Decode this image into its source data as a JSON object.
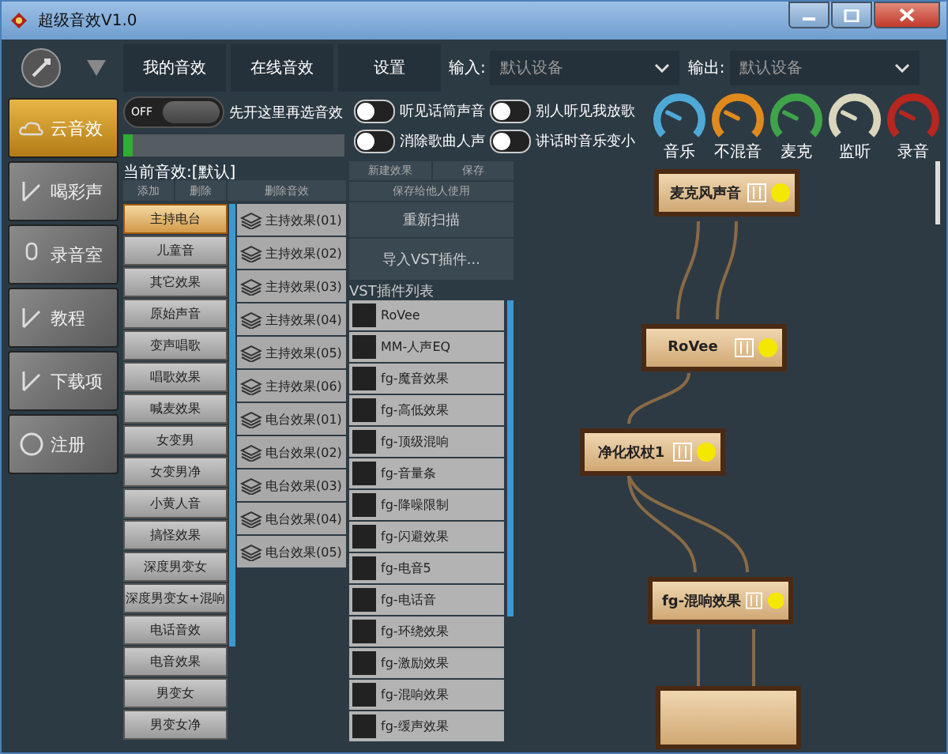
{
  "window": {
    "title": "超级音效V1.0"
  },
  "sidebar": {
    "items": [
      {
        "label": "云音效",
        "selected": true
      },
      {
        "label": "喝彩声",
        "selected": false
      },
      {
        "label": "录音室",
        "selected": false
      },
      {
        "label": "教程",
        "selected": false
      },
      {
        "label": "下载项",
        "selected": false
      },
      {
        "label": "注册",
        "selected": false
      }
    ]
  },
  "tabs": [
    {
      "label": "我的音效",
      "selected": false
    },
    {
      "label": "在线音效",
      "selected": false
    },
    {
      "label": "设置",
      "selected": false
    }
  ],
  "input": {
    "label": "输入:",
    "value": "默认设备"
  },
  "output": {
    "label": "输出:",
    "value": "默认设备"
  },
  "main_switch": {
    "label": "OFF",
    "on": false,
    "hint": "先开这里再选音效"
  },
  "input_meter": {
    "level": 0.04
  },
  "toggles": [
    {
      "label": "听见话筒声音",
      "on": false
    },
    {
      "label": "别人听见我放歌",
      "on": false
    },
    {
      "label": "消除歌曲人声",
      "on": false
    },
    {
      "label": "讲话时音乐变小",
      "on": false
    }
  ],
  "gauges": [
    {
      "label": "音乐",
      "color": "#4fa9d6"
    },
    {
      "label": "不混音",
      "color": "#e08a1e"
    },
    {
      "label": "麦克",
      "color": "#3fa34a"
    },
    {
      "label": "监听",
      "color": "#d9d6bd"
    },
    {
      "label": "录音",
      "color": "#b8261f"
    }
  ],
  "current_effect": "当前音效:[默认]",
  "effect_columns": [
    "添加",
    "删除",
    "删除音效"
  ],
  "effects": [
    {
      "label": "主持电台",
      "selected": true
    },
    {
      "label": "儿童音",
      "selected": false
    },
    {
      "label": "其它效果",
      "selected": false
    },
    {
      "label": "原始声音",
      "selected": false
    },
    {
      "label": "变声唱歌",
      "selected": false
    },
    {
      "label": "唱歌效果",
      "selected": false
    },
    {
      "label": "喊麦效果",
      "selected": false
    },
    {
      "label": "女变男",
      "selected": false
    },
    {
      "label": "女变男净",
      "selected": false
    },
    {
      "label": "小黄人音",
      "selected": false
    },
    {
      "label": "搞怪效果",
      "selected": false
    },
    {
      "label": "深度男变女",
      "selected": false
    },
    {
      "label": "深度男变女+混响",
      "selected": false
    },
    {
      "label": "电话音效",
      "selected": false
    },
    {
      "label": "电音效果",
      "selected": false
    },
    {
      "label": "男变女",
      "selected": false
    },
    {
      "label": "男变女净",
      "selected": false
    }
  ],
  "presets": [
    "主持效果(01)",
    "主持效果(02)",
    "主持效果(03)",
    "主持效果(04)",
    "主持效果(05)",
    "主持效果(06)",
    "电台效果(01)",
    "电台效果(02)",
    "电台效果(03)",
    "电台效果(04)",
    "电台效果(05)"
  ],
  "vst_panel": {
    "buttons": [
      "新建效果",
      "保存"
    ],
    "share_button": "保存给他人使用",
    "rescan_button": "重新扫描",
    "import_button": "导入VST插件...",
    "list_title": "VST插件列表",
    "plugins": [
      "RoVee",
      "MM-人声EQ",
      "fg-魔音效果",
      "fg-高低效果",
      "fg-顶级混响",
      "fg-音量条",
      "fg-降噪限制",
      "fg-闪避效果",
      "fg-电音5",
      "fg-电话音",
      "fg-环绕效果",
      "fg-激励效果",
      "fg-混响效果",
      "fg-缓声效果"
    ]
  },
  "graph": {
    "nodes": [
      {
        "label": "麦克风声音"
      },
      {
        "label": "RoVee"
      },
      {
        "label": "净化权杖1"
      },
      {
        "label": "fg-混响效果"
      }
    ]
  }
}
